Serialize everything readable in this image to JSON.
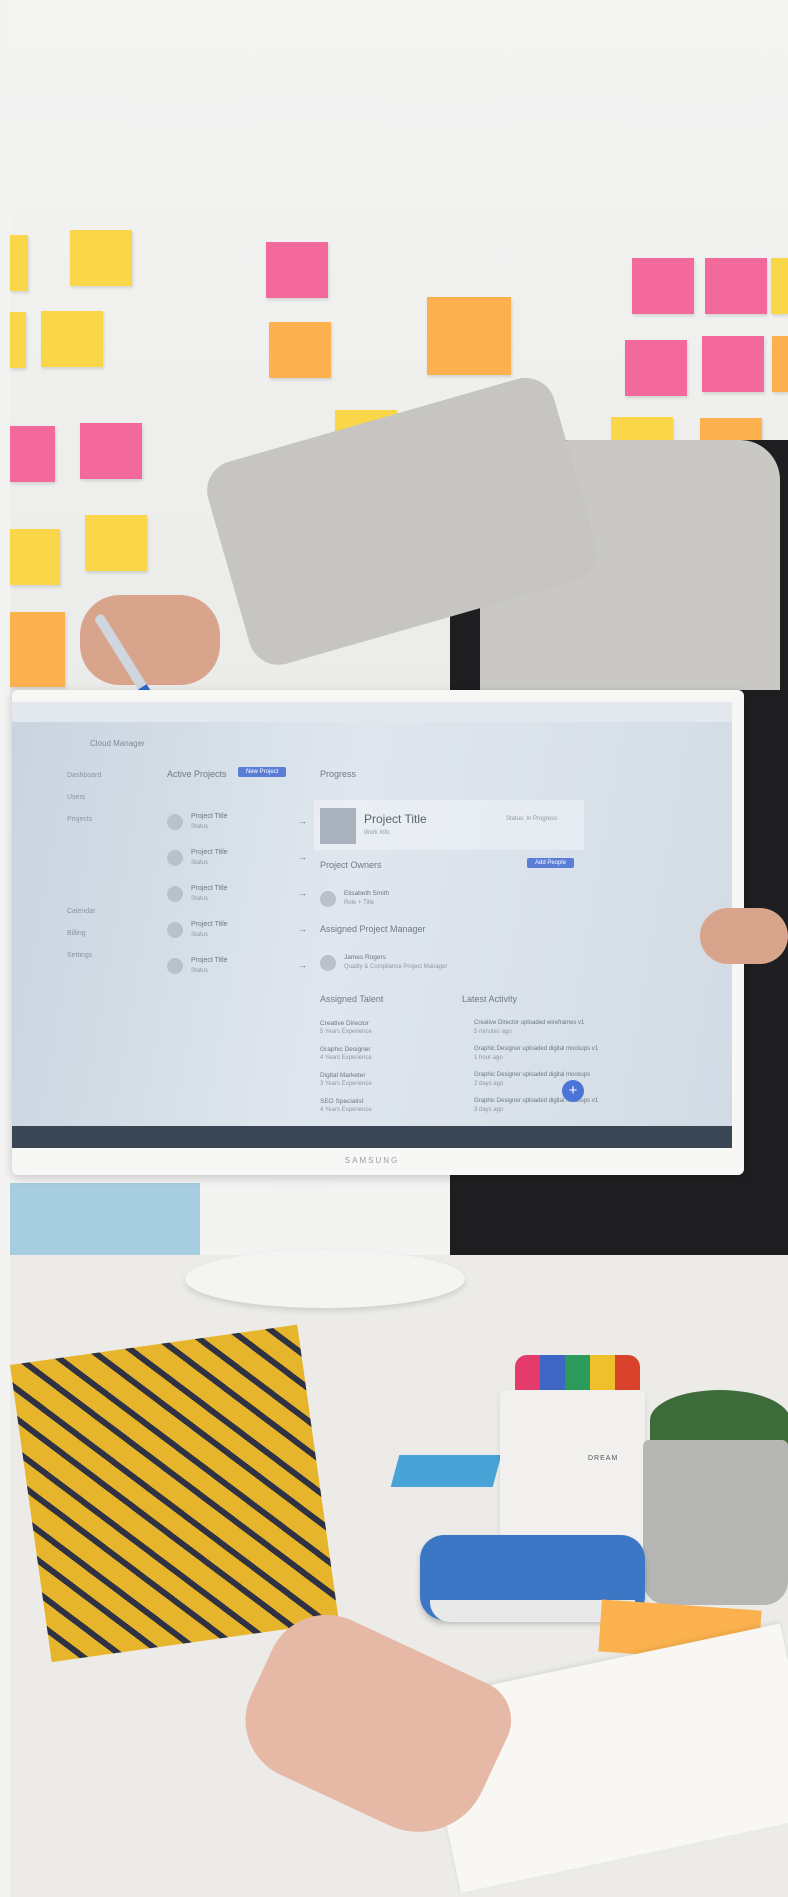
{
  "monitor": {
    "brand": "SAMSUNG",
    "app": {
      "name": "Cloud Manager",
      "nav": [
        "Dashboard",
        "Users",
        "Projects",
        "Calendar",
        "Billing",
        "Settings"
      ]
    },
    "active_projects": {
      "heading": "Active Projects",
      "new_button": "New Project",
      "items": [
        {
          "title": "Project Title",
          "status": "Status"
        },
        {
          "title": "Project Title",
          "status": "Status"
        },
        {
          "title": "Project Title",
          "status": "Status"
        },
        {
          "title": "Project Title",
          "status": "Status"
        },
        {
          "title": "Project Title",
          "status": "Status"
        }
      ]
    },
    "progress": {
      "heading": "Progress"
    },
    "project_detail": {
      "title": "Project Title",
      "subtitle": "Work Info",
      "status": "Status: In Progress"
    },
    "project_owners": {
      "heading": "Project Owners",
      "add_button": "Add People",
      "person": {
        "name": "Elisabeth Smith",
        "role": "Role + Title"
      }
    },
    "assigned_manager": {
      "heading": "Assigned Project Manager",
      "person": {
        "name": "James Rogers",
        "role": "Quality & Compliance Project Manager"
      }
    },
    "assigned_talent": {
      "heading": "Assigned Talent",
      "items": [
        {
          "role": "Creative Director",
          "exp": "5 Years Experience"
        },
        {
          "role": "Graphic Designer",
          "exp": "4 Years Experience"
        },
        {
          "role": "Digital Marketer",
          "exp": "3 Years Experience"
        },
        {
          "role": "SEO Specialist",
          "exp": "4 Years Experience"
        }
      ]
    },
    "latest_activity": {
      "heading": "Latest Activity",
      "items": [
        {
          "text": "Creative Director uploaded wireframes v1",
          "time": "5 minutes ago"
        },
        {
          "text": "Graphic Designer uploaded digital mockups v1",
          "time": "1 hour ago"
        },
        {
          "text": "Graphic Designer uploaded digital mockups",
          "time": "2 days ago"
        },
        {
          "text": "Graphic Designer uploaded digital mockups v1",
          "time": "3 days ago"
        }
      ]
    },
    "fab": "+"
  },
  "mug_label": "DREAM",
  "colors": {
    "accent": "#5a7ed6",
    "note_yellow": "#f9d749",
    "note_pink": "#f4699c",
    "note_orange": "#fbb14e"
  }
}
